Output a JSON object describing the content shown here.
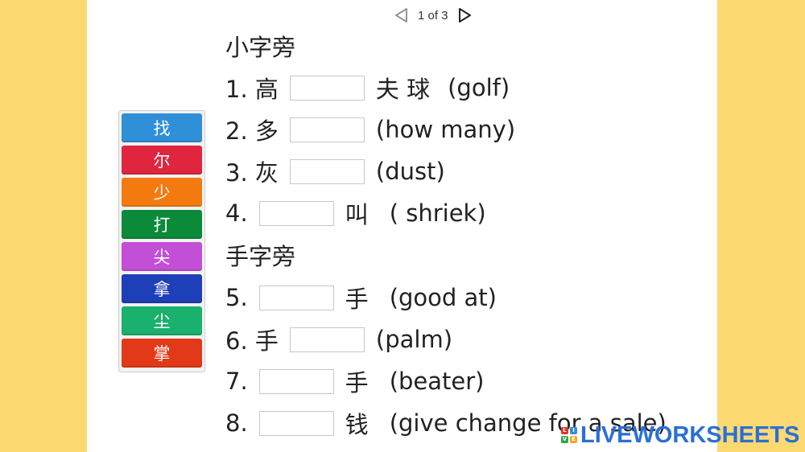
{
  "pager": {
    "label": "1 of 3"
  },
  "word_bank": [
    {
      "text": "找",
      "color": "#2f8fd8"
    },
    {
      "text": "尔",
      "color": "#e0263f"
    },
    {
      "text": "少",
      "color": "#f47a10"
    },
    {
      "text": "打",
      "color": "#0b8a3a"
    },
    {
      "text": "尖",
      "color": "#c34fd6"
    },
    {
      "text": "拿",
      "color": "#1d3fb8"
    },
    {
      "text": "尘",
      "color": "#1ab06e"
    },
    {
      "text": "掌",
      "color": "#e23a18"
    }
  ],
  "sections": {
    "s1": "小字旁",
    "s2": "手字旁"
  },
  "lines": {
    "l1": {
      "num": "1. 高",
      "after": "夫 球",
      "hint": "(golf)"
    },
    "l2": {
      "num": "2. 多",
      "hint": "(how many)"
    },
    "l3": {
      "num": "3. 灰",
      "hint": "(dust)"
    },
    "l4": {
      "num": "4.",
      "after": "叫",
      "hint": "( shriek)"
    },
    "l5": {
      "num": "5.",
      "after": "手",
      "hint": "(good at)"
    },
    "l6": {
      "num": "6. 手",
      "hint": "(palm)"
    },
    "l7": {
      "num": "7.",
      "after": "手",
      "hint": "(beater)"
    },
    "l8": {
      "num": "8.",
      "after": "钱",
      "hint": "(give change for a sale)"
    }
  },
  "brand": {
    "name": "LIVEWORKSHEETS",
    "logo_letters": [
      "L",
      "I",
      "V",
      "E"
    ],
    "logo_colors": [
      "#e8342a",
      "#2f8fd8",
      "#29a84a",
      "#f5a623"
    ],
    "text_color": "#2b6fd6"
  }
}
